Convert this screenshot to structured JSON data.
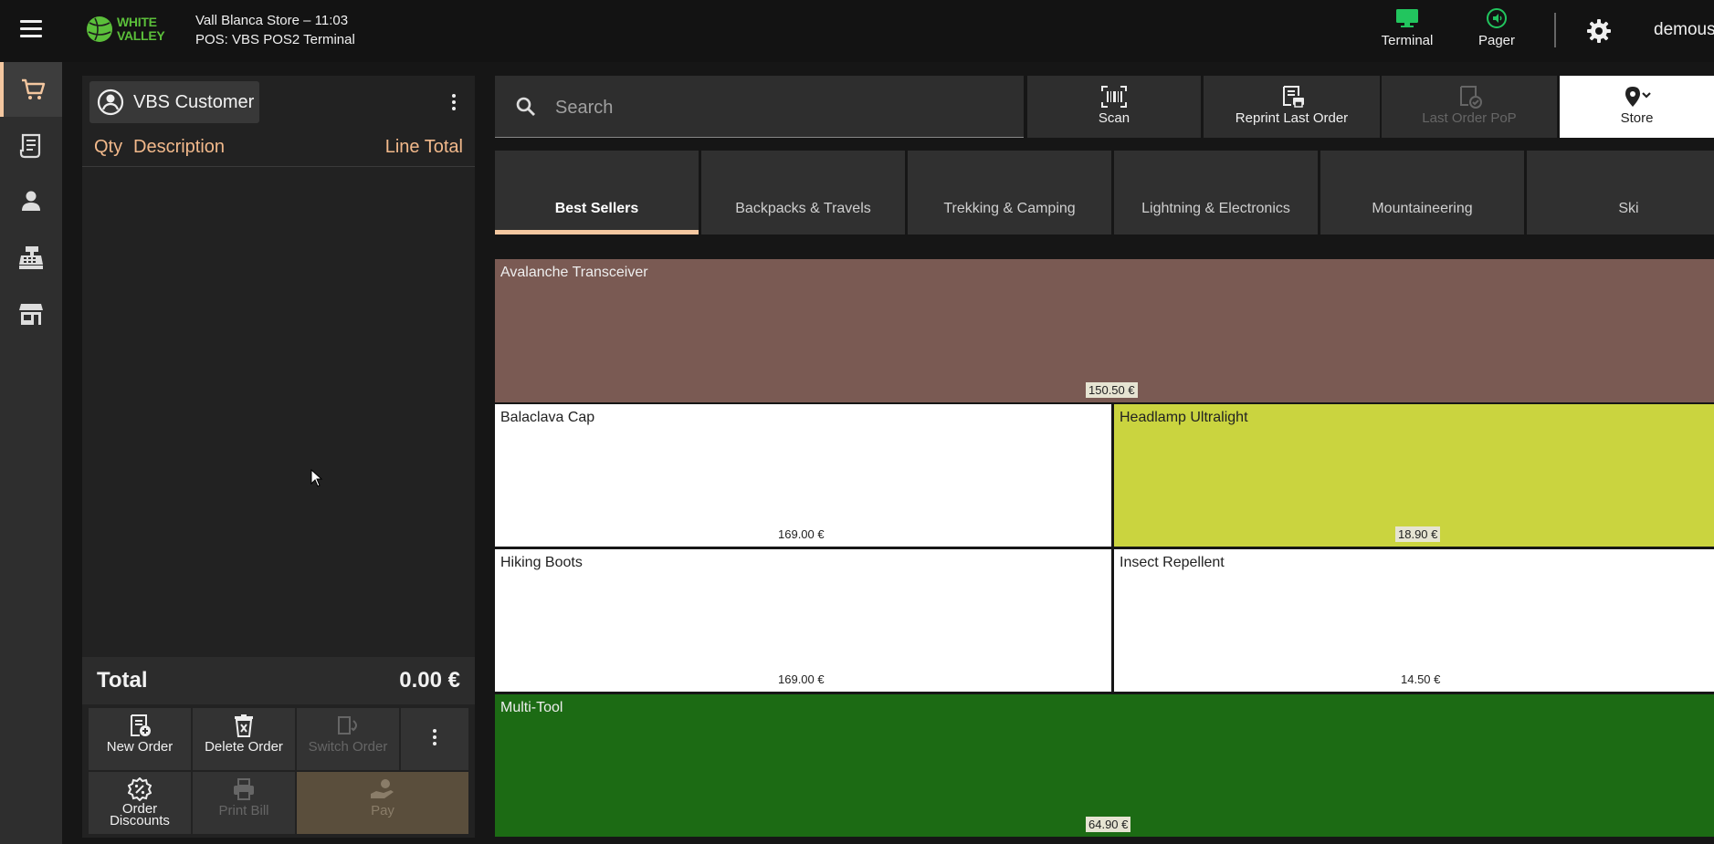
{
  "header": {
    "logo_text_line1": "WHITE",
    "logo_text_line2": "VALLEY",
    "store_line": "Vall Blanca Store – 11:03",
    "pos_line": "POS: VBS POS2 Terminal",
    "terminal_label": "Terminal",
    "pager_label": "Pager",
    "user_name": "demouser",
    "accent_color": "#22c55e"
  },
  "nav": {
    "items": [
      "cart-icon",
      "receipt-icon",
      "person-icon",
      "cash-register-icon",
      "store-icon"
    ],
    "active": "cart-icon",
    "active_color": "#f4c7a0"
  },
  "order": {
    "customer": "VBS Customer",
    "columns": {
      "qty": "Qty",
      "description": "Description",
      "line_total": "Line Total"
    },
    "total_label": "Total",
    "total_value": "0.00 €",
    "actions": {
      "new_order": "New Order",
      "delete_order": "Delete Order",
      "switch_order": "Switch Order",
      "order_discounts_line1": "Order",
      "order_discounts_line2": "Discounts",
      "print_bill": "Print Bill",
      "pay": "Pay"
    }
  },
  "toolbar": {
    "search_placeholder": "Search",
    "scan": "Scan",
    "reprint_last_order": "Reprint Last Order",
    "last_order_pop": "Last Order PoP",
    "store": "Store"
  },
  "categories": [
    {
      "label": "Best Sellers",
      "active": true
    },
    {
      "label": "Backpacks & Travels",
      "active": false
    },
    {
      "label": "Trekking & Camping",
      "active": false
    },
    {
      "label": "Lightning & Electronics",
      "active": false
    },
    {
      "label": "Mountaineering",
      "active": false
    },
    {
      "label": "Ski",
      "active": false
    }
  ],
  "products": [
    {
      "name": "Avalanche Transceiver",
      "price": "150.50 €",
      "color": "#7a5a53"
    },
    {
      "name": "Balaclava Cap",
      "price": "169.00 €",
      "color": "#ffffff"
    },
    {
      "name": "Headlamp Ultralight",
      "price": "18.90 €",
      "color": "#cad43f"
    },
    {
      "name": "Hiking Boots",
      "price": "169.00 €",
      "color": "#ffffff"
    },
    {
      "name": "Insect Repellent",
      "price": "14.50 €",
      "color": "#ffffff"
    },
    {
      "name": "Multi-Tool",
      "price": "64.90 €",
      "color": "#1c6b14"
    }
  ]
}
